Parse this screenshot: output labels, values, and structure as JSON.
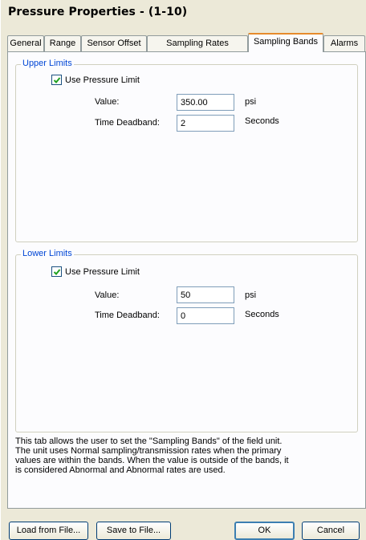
{
  "window": {
    "title": "Pressure Properties -  (1-10)"
  },
  "tabs": [
    {
      "label": "General",
      "active": false
    },
    {
      "label": "Range",
      "active": false
    },
    {
      "label": "Sensor Offset",
      "active": false
    },
    {
      "label": "Sampling Rates",
      "active": false
    },
    {
      "label": "Sampling Bands",
      "active": true
    },
    {
      "label": "Alarms",
      "active": false
    }
  ],
  "upper": {
    "group_label": "Upper Limits",
    "checkbox_label": "Use Pressure Limit",
    "checked": true,
    "value_label": "Value:",
    "value": "350.00",
    "value_unit": "psi",
    "deadband_label": "Time Deadband:",
    "deadband": "2",
    "deadband_unit": "Seconds"
  },
  "lower": {
    "group_label": "Lower Limits",
    "checkbox_label": "Use Pressure Limit",
    "checked": true,
    "value_label": "Value:",
    "value": "50",
    "value_unit": "psi",
    "deadband_label": "Time Deadband:",
    "deadband": "0",
    "deadband_unit": "Seconds"
  },
  "description": "This tab allows the user to set the \"Sampling Bands\" of the field unit.\nThe unit uses Normal sampling/transmission rates when the primary\nvalues are within the bands.  When the value is outside of the bands, it\nis considered Abnormal and Abnormal rates are used.",
  "buttons": {
    "load": "Load from File...",
    "save": "Save to File...",
    "ok": "OK",
    "cancel": "Cancel"
  },
  "colors": {
    "group_label": "#0046d5",
    "active_tab_accent": "#e68b2c",
    "dialog_bg": "#ece9d8"
  }
}
